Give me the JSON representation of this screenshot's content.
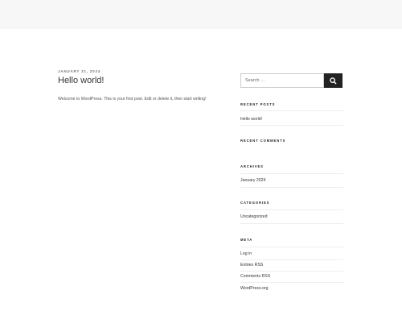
{
  "post": {
    "date": "January 31, 2024",
    "title": "Hello world!",
    "content": "Welcome to WordPress. This is your first post. Edit or delete it, then start writing!"
  },
  "sidebar": {
    "search": {
      "placeholder": "Search …"
    },
    "recent_posts": {
      "title": "Recent Posts",
      "items": [
        "Hello world!"
      ]
    },
    "recent_comments": {
      "title": "Recent Comments"
    },
    "archives": {
      "title": "Archives",
      "items": [
        "January 2024"
      ]
    },
    "categories": {
      "title": "Categories",
      "items": [
        "Uncategorized"
      ]
    },
    "meta": {
      "title": "Meta",
      "items": [
        "Log in",
        "Entries RSS",
        "Comments RSS",
        "WordPress.org"
      ]
    }
  }
}
